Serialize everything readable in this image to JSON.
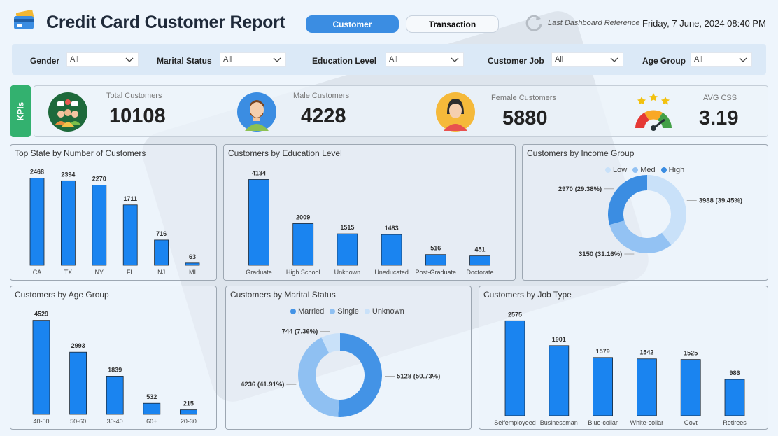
{
  "header": {
    "title": "Credit Card Customer Report",
    "nav": {
      "customer": "Customer",
      "transaction": "Transaction"
    },
    "ref_label": "Last Dashboard Reference",
    "ref_date": "Friday, 7 June, 2024   08:40 PM"
  },
  "filters": [
    {
      "label": "Gender",
      "value": "All"
    },
    {
      "label": "Marital Status",
      "value": "All"
    },
    {
      "label": "Education Level",
      "value": "All"
    },
    {
      "label": "Customer Job",
      "value": "All"
    },
    {
      "label": "Age Group",
      "value": "All"
    }
  ],
  "kpis": {
    "tag": "KPIs",
    "items": [
      {
        "label": "Total Customers",
        "value": "10108"
      },
      {
        "label": "Male Customers",
        "value": "4228"
      },
      {
        "label": "Female Customers",
        "value": "5880"
      },
      {
        "label": "AVG CSS",
        "value": "3.19"
      }
    ]
  },
  "colors": {
    "bar": "#1a84f0",
    "low": "#c9e1f9",
    "med": "#93c2f3",
    "high": "#3b8de2",
    "married": "#4393e6",
    "single": "#8fc0f2",
    "unknown": "#c9e1f9",
    "accent": "#3b8de2",
    "kpi_tag": "#33b16f"
  },
  "chart_data": [
    {
      "id": "state",
      "type": "bar",
      "title": "Top State by Number of Customers",
      "categories": [
        "CA",
        "TX",
        "NY",
        "FL",
        "NJ",
        "MI"
      ],
      "values": [
        2468,
        2394,
        2270,
        1711,
        716,
        63
      ],
      "ylim": [
        0,
        2500
      ]
    },
    {
      "id": "education",
      "type": "bar",
      "title": "Customers by Education Level",
      "categories": [
        "Graduate",
        "High School",
        "Unknown",
        "Uneducated",
        "Post-Graduate",
        "Doctorate"
      ],
      "values": [
        4134,
        2009,
        1515,
        1483,
        516,
        451
      ],
      "ylim": [
        0,
        4150
      ]
    },
    {
      "id": "income",
      "type": "pie",
      "title": "Customers by Income Group",
      "legend": [
        "Low",
        "Med",
        "High"
      ],
      "values": [
        3988,
        3150,
        2970
      ],
      "labels": [
        "3988 (39.45%)",
        "3150 (31.16%)",
        "2970 (29.38%)"
      ]
    },
    {
      "id": "age",
      "type": "bar",
      "title": "Customers by Age Group",
      "categories": [
        "40-50",
        "50-60",
        "30-40",
        "60+",
        "20-30"
      ],
      "values": [
        4529,
        2993,
        1839,
        532,
        215
      ],
      "ylim": [
        0,
        4550
      ]
    },
    {
      "id": "marital",
      "type": "pie",
      "title": "Customers by Marital Status",
      "legend": [
        "Married",
        "Single",
        "Unknown"
      ],
      "values": [
        5128,
        4236,
        744
      ],
      "labels": [
        "5128 (50.73%)",
        "4236 (41.91%)",
        "744 (7.36%)"
      ]
    },
    {
      "id": "job",
      "type": "bar",
      "title": "Customers by Job Type",
      "categories": [
        "Selfemployeed",
        "Businessman",
        "Blue-collar",
        "White-collar",
        "Govt",
        "Retirees"
      ],
      "values": [
        2575,
        1901,
        1579,
        1542,
        1525,
        986
      ],
      "ylim": [
        0,
        2600
      ]
    }
  ]
}
